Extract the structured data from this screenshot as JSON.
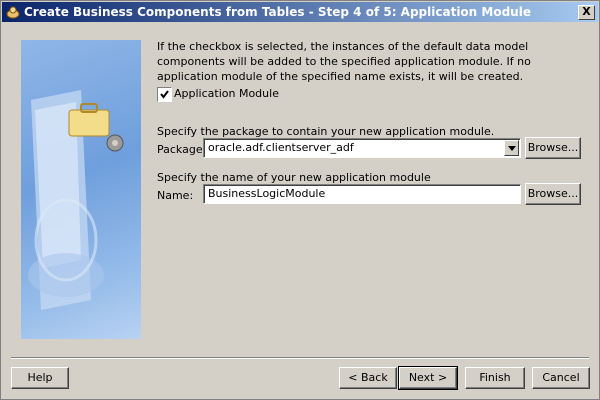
{
  "window": {
    "title": "Create Business Components from Tables - Step 4 of 5: Application Module",
    "close_label": "X"
  },
  "content": {
    "message": "If the checkbox is selected, the instances of the default data model components will be added to the specified application module.  If no application module of the specified name exists, it will be created.",
    "checkbox": {
      "label": "Application Module",
      "checked": true
    },
    "package_section": {
      "instruction": "Specify the package to contain your new application module.",
      "label": "Package:",
      "value": "oracle.adf.clientserver_adf",
      "browse_label": "Browse..."
    },
    "name_section": {
      "instruction": "Specify the name of your new application module",
      "label": "Name:",
      "value": "BusinessLogicModule",
      "browse_label": "Browse..."
    }
  },
  "buttons": {
    "help": "Help",
    "back": "< Back",
    "next": "Next >",
    "finish": "Finish",
    "cancel": "Cancel"
  },
  "icons": [
    "wizard-icon",
    "close-icon",
    "chevron-down-icon",
    "wizard-illustration"
  ]
}
